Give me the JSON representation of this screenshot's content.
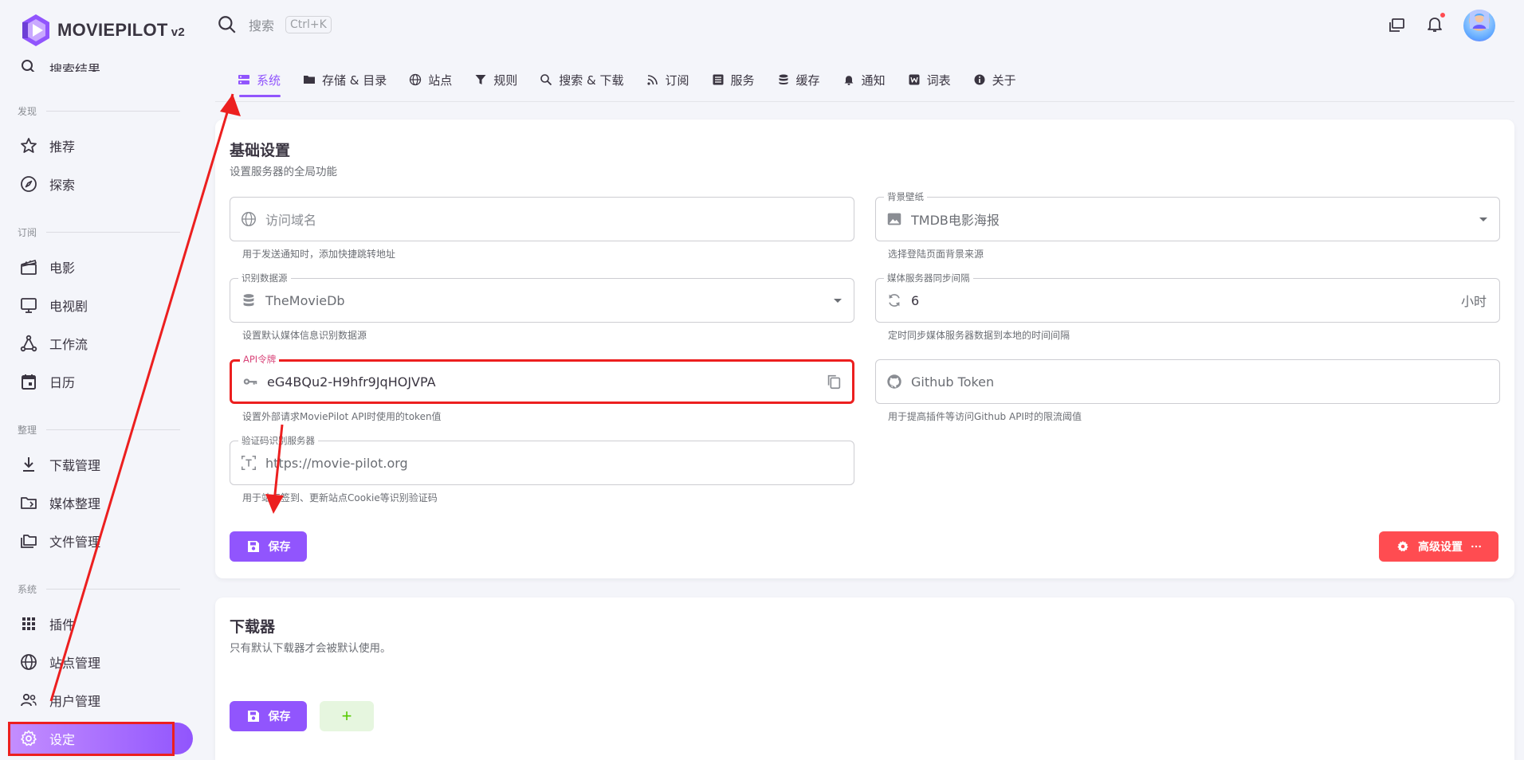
{
  "app": {
    "name": "MOVIEPILOT",
    "version": "v2"
  },
  "sidebar": {
    "partial_item": "搜索结果",
    "sections": {
      "discover": "发现",
      "subscribe": "订阅",
      "organize": "整理",
      "system": "系统"
    },
    "items": {
      "recommend": "推荐",
      "explore": "探索",
      "movie": "电影",
      "tv": "电视剧",
      "workflow": "工作流",
      "calendar": "日历",
      "download_manage": "下载管理",
      "media_organize": "媒体整理",
      "file_manage": "文件管理",
      "plugins": "插件",
      "site_manage": "站点管理",
      "user_manage": "用户管理",
      "settings": "设定"
    }
  },
  "topbar": {
    "search_placeholder": "搜索",
    "search_shortcut": "Ctrl+K"
  },
  "tabs": [
    {
      "label": "系统",
      "icon": "server-icon"
    },
    {
      "label": "存储 & 目录",
      "icon": "folder-icon"
    },
    {
      "label": "站点",
      "icon": "globe-icon"
    },
    {
      "label": "规则",
      "icon": "filter-icon"
    },
    {
      "label": "搜索 & 下载",
      "icon": "search-icon"
    },
    {
      "label": "订阅",
      "icon": "rss-icon"
    },
    {
      "label": "服务",
      "icon": "list-icon"
    },
    {
      "label": "缓存",
      "icon": "database-icon"
    },
    {
      "label": "通知",
      "icon": "bell-icon"
    },
    {
      "label": "词表",
      "icon": "word-icon"
    },
    {
      "label": "关于",
      "icon": "info-icon"
    }
  ],
  "basic": {
    "title": "基础设置",
    "subtitle": "设置服务器的全局功能",
    "fields": {
      "domain": {
        "placeholder": "访问域名",
        "hint": "用于发送通知时，添加快捷跳转地址"
      },
      "wallpaper": {
        "label": "背景壁纸",
        "value": "TMDB电影海报",
        "hint": "选择登陆页面背景来源"
      },
      "recognize": {
        "label": "识别数据源",
        "value": "TheMovieDb",
        "hint": "设置默认媒体信息识别数据源"
      },
      "sync": {
        "label": "媒体服务器同步间隔",
        "value": "6",
        "suffix": "小时",
        "hint": "定时同步媒体服务器数据到本地的时间间隔"
      },
      "api_token": {
        "label": "API令牌",
        "value": "eG4BQu2-H9hfr9JqHOJVPA",
        "hint": "设置外部请求MoviePilot API时使用的token值"
      },
      "github": {
        "placeholder": "Github Token",
        "hint": "用于提高插件等访问Github API时的限流阈值"
      },
      "captcha": {
        "label": "验证码识别服务器",
        "value": "https://movie-pilot.org",
        "hint": "用于站点签到、更新站点Cookie等识别验证码"
      }
    },
    "save_label": "保存",
    "advanced_label": "高级设置"
  },
  "downloader": {
    "title": "下载器",
    "subtitle": "只有默认下载器才会被默认使用。",
    "save_label": "保存",
    "add_label": "+"
  },
  "colors": {
    "primary": "#9155fd",
    "danger": "#ff4c51",
    "annotation": "#ec1f1f",
    "success": "#56ca00"
  }
}
